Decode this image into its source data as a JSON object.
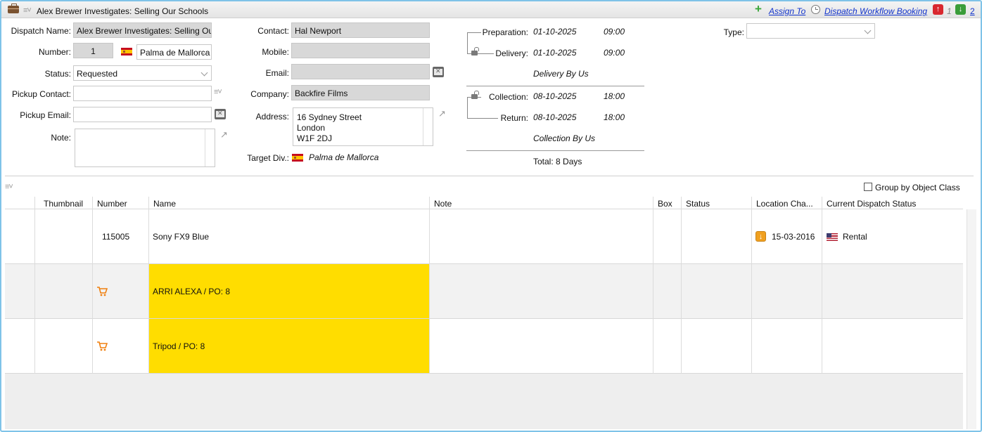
{
  "window": {
    "title": "Alex Brewer Investigates: Selling Our Schools",
    "assign_to": "Assign To",
    "workflow_link": "Dispatch Workflow Booking",
    "count_up": "1",
    "count_down": "2"
  },
  "form": {
    "dispatch_name_label": "Dispatch Name:",
    "dispatch_name_value": "Alex Brewer Investigates: Selling Our Schools",
    "number_label": "Number:",
    "number_value": "1",
    "location_value": "Palma de Mallorca",
    "status_label": "Status:",
    "status_value": "Requested",
    "pickup_contact_label": "Pickup Contact:",
    "pickup_contact_value": "",
    "pickup_email_label": "Pickup Email:",
    "pickup_email_value": "",
    "note_label": "Note:",
    "contact_label": "Contact:",
    "contact_value": "Hal Newport",
    "mobile_label": "Mobile:",
    "mobile_value": "",
    "email_label": "Email:",
    "email_value": "",
    "company_label": "Company:",
    "company_value": "Backfire Films",
    "address_label": "Address:",
    "address_line1": "16 Sydney Street",
    "address_line2": "London",
    "address_line3": "W1F 2DJ",
    "target_div_label": "Target Div.:",
    "target_div_value": "Palma de Mallorca",
    "type_label": "Type:",
    "type_value": ""
  },
  "schedule": {
    "preparation_label": "Preparation:",
    "preparation_date": "01-10-2025",
    "preparation_time": "09:00",
    "delivery_label": "Delivery:",
    "delivery_date": "01-10-2025",
    "delivery_time": "09:00",
    "delivery_by": "Delivery By Us",
    "collection_label": "Collection:",
    "collection_date": "08-10-2025",
    "collection_time": "18:00",
    "return_label": "Return:",
    "return_date": "08-10-2025",
    "return_time": "18:00",
    "collection_by": "Collection By Us",
    "total": "Total: 8 Days"
  },
  "grid": {
    "group_by_label": "Group by Object Class",
    "columns": {
      "thumbnail": "Thumbnail",
      "number": "Number",
      "name": "Name",
      "note": "Note",
      "box": "Box",
      "status": "Status",
      "location_change": "Location Cha...",
      "current_dispatch_status": "Current Dispatch Status"
    },
    "rows": [
      {
        "number": "115005",
        "name": "Sony FX9 Blue",
        "location_date": "15-03-2016",
        "dispatch_status": "Rental"
      },
      {
        "name": "ARRI ALEXA / PO: 8"
      },
      {
        "name": "Tripod / PO: 8"
      }
    ]
  },
  "colors": {
    "highlight": "#ffdd00",
    "link": "#1133cc",
    "readonly_field": "#d8d8d8",
    "accent_border": "#7fc3e8"
  }
}
